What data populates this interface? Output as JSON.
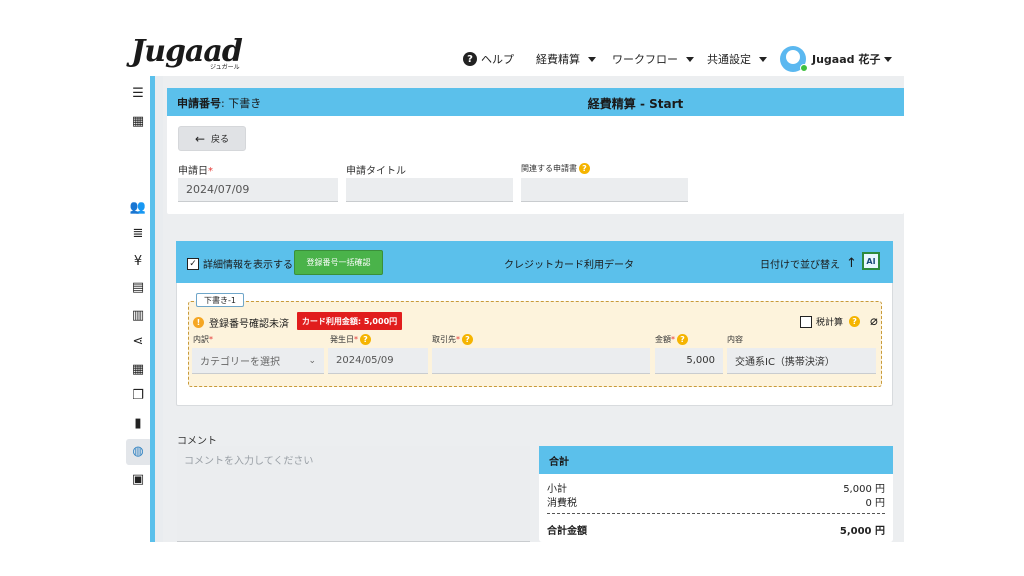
{
  "header": {
    "logo": "Jugaad",
    "logo_sub": "ジュガール",
    "help": "ヘルプ",
    "menu": [
      "経費精算",
      "ワークフロー",
      "共通設定"
    ],
    "user": "Jugaad 花子"
  },
  "request": {
    "number_label": "申請番号",
    "number_value": ": 下書き",
    "title": "経費精算 - Start",
    "back": "戻る",
    "date_label": "申請日",
    "date_value": "2024/07/09",
    "title_label": "申請タイトル",
    "title_value": "",
    "related_label": "関連する申請書",
    "related_value": ""
  },
  "credit": {
    "show_detail": "詳細情報を表示する",
    "bulk_check": "登録番号一括確認",
    "section_title": "クレジットカード利用データ",
    "sort": "日付けで並び替え",
    "sort_arrow": "↑",
    "ai_icon": "AI",
    "draft_tag": "下書き-1",
    "unconfirmed": "登録番号確認未済",
    "card_amount": "カード利用金額: 5,000円",
    "tax_calc": "税計算",
    "labels": {
      "category": "内訳",
      "date": "発生日",
      "vendor": "取引先",
      "amount": "金額",
      "content": "内容"
    },
    "category_placeholder": "カテゴリーを選択",
    "date_value": "2024/05/09",
    "vendor_value": "",
    "amount_value": "5,000",
    "content_value": "交通系IC（携帯決済）"
  },
  "comment": {
    "label": "コメント",
    "placeholder": "コメントを入力してください"
  },
  "totals": {
    "title": "合計",
    "subtotal_label": "小計",
    "subtotal_value": "5,000 円",
    "tax_label": "消費税",
    "tax_value": "0 円",
    "total_label": "合計金額",
    "total_value": "5,000 円"
  },
  "colors": {
    "accent": "#5bc0eb",
    "green": "#4ab34a",
    "red": "#e11d1d",
    "warning": "#f5a623"
  }
}
